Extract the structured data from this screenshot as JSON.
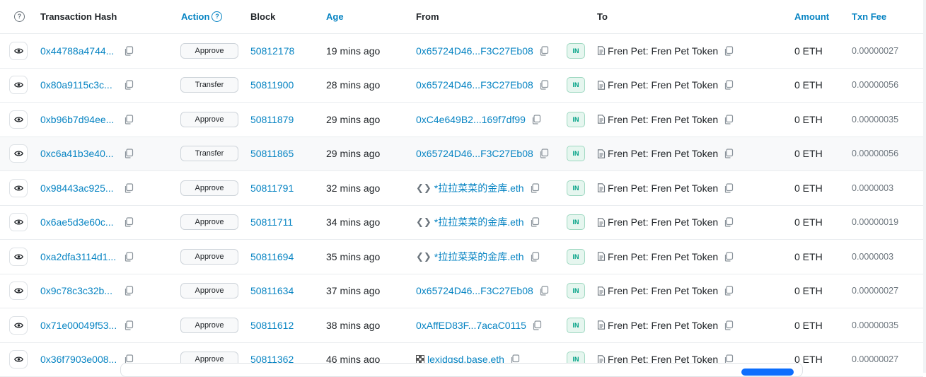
{
  "header": {
    "col_hash": "Transaction Hash",
    "col_action": "Action",
    "col_block": "Block",
    "col_age": "Age",
    "col_from": "From",
    "col_to": "To",
    "col_amount": "Amount",
    "col_fee": "Txn Fee",
    "help_icon": "?"
  },
  "rows": [
    {
      "hash": "0x44788a4744...",
      "method": "Approve",
      "block": "50812178",
      "age": "19 mins ago",
      "from": "0x65724D46...F3C27Eb08",
      "from_kind": "address",
      "direction": "IN",
      "to": "Fren Pet: Fren Pet Token",
      "amount": "0 ETH",
      "fee": "0.00000027"
    },
    {
      "hash": "0x80a9115c3c...",
      "method": "Transfer",
      "block": "50811900",
      "age": "28 mins ago",
      "from": "0x65724D46...F3C27Eb08",
      "from_kind": "address",
      "direction": "IN",
      "to": "Fren Pet: Fren Pet Token",
      "amount": "0 ETH",
      "fee": "0.00000056"
    },
    {
      "hash": "0xb96b7d94ee...",
      "method": "Approve",
      "block": "50811879",
      "age": "29 mins ago",
      "from": "0xC4e649B2...169f7df99",
      "from_kind": "address",
      "direction": "IN",
      "to": "Fren Pet: Fren Pet Token",
      "amount": "0 ETH",
      "fee": "0.00000035"
    },
    {
      "hash": "0xc6a41b3e40...",
      "method": "Transfer",
      "block": "50811865",
      "age": "29 mins ago",
      "from": "0x65724D46...F3C27Eb08",
      "from_kind": "address",
      "direction": "IN",
      "to": "Fren Pet: Fren Pet Token",
      "amount": "0 ETH",
      "fee": "0.00000056"
    },
    {
      "hash": "0x98443ac925...",
      "method": "Approve",
      "block": "50811791",
      "age": "32 mins ago",
      "from": "*拉拉菜菜的金库.eth",
      "from_kind": "ens",
      "direction": "IN",
      "to": "Fren Pet: Fren Pet Token",
      "amount": "0 ETH",
      "fee": "0.0000003"
    },
    {
      "hash": "0x6ae5d3e60c...",
      "method": "Approve",
      "block": "50811711",
      "age": "34 mins ago",
      "from": "*拉拉菜菜的金库.eth",
      "from_kind": "ens",
      "direction": "IN",
      "to": "Fren Pet: Fren Pet Token",
      "amount": "0 ETH",
      "fee": "0.00000019"
    },
    {
      "hash": "0xa2dfa3114d1...",
      "method": "Approve",
      "block": "50811694",
      "age": "35 mins ago",
      "from": "*拉拉菜菜的金库.eth",
      "from_kind": "ens",
      "direction": "IN",
      "to": "Fren Pet: Fren Pet Token",
      "amount": "0 ETH",
      "fee": "0.0000003"
    },
    {
      "hash": "0x9c78c3c32b...",
      "method": "Approve",
      "block": "50811634",
      "age": "37 mins ago",
      "from": "0x65724D46...F3C27Eb08",
      "from_kind": "address",
      "direction": "IN",
      "to": "Fren Pet: Fren Pet Token",
      "amount": "0 ETH",
      "fee": "0.00000027"
    },
    {
      "hash": "0x71e00049f53...",
      "method": "Approve",
      "block": "50811612",
      "age": "38 mins ago",
      "from": "0xAffED83F...7acaC0115",
      "from_kind": "address",
      "direction": "IN",
      "to": "Fren Pet: Fren Pet Token",
      "amount": "0 ETH",
      "fee": "0.00000035"
    },
    {
      "hash": "0x36f7903e008...",
      "method": "Approve",
      "block": "50811362",
      "age": "46 mins ago",
      "from": "lexidgsd.base.eth",
      "from_kind": "basename",
      "direction": "IN",
      "to": "Fren Pet: Fren Pet Token",
      "amount": "0 ETH",
      "fee": "0.00000027"
    }
  ],
  "colors": {
    "link": "#0784c3",
    "in_badge_bg": "#e6f6ef",
    "in_badge_text": "#00a186",
    "row_highlight": "#f8f9fa"
  }
}
